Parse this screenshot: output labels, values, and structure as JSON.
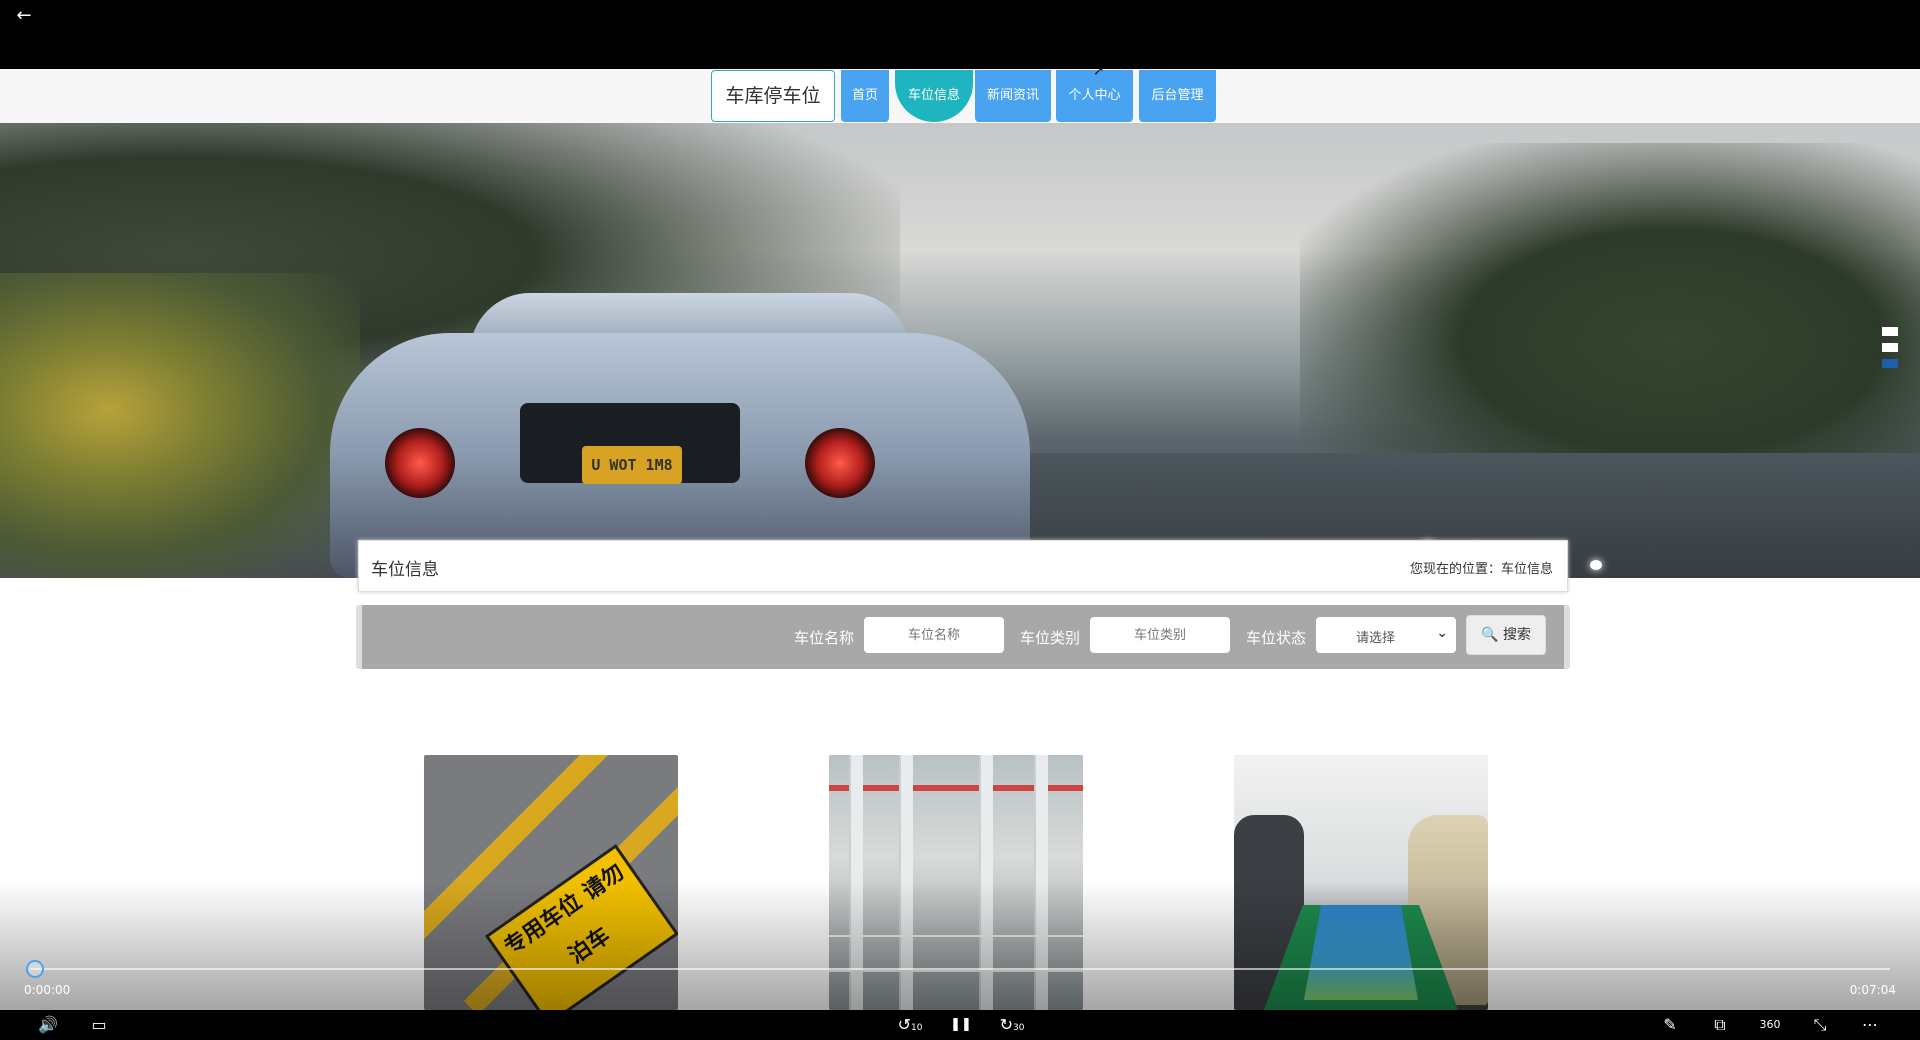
{
  "player": {
    "back_glyph": "←",
    "time_current": "0:00:00",
    "time_total": "0:07:04",
    "progress": 0.0,
    "controls": {
      "volume": "🔊",
      "subtitles": "▭",
      "rewind": "↺",
      "rewind_label": "10",
      "pause": "❚❚",
      "forward": "↻",
      "forward_label": "30",
      "pen": "✎",
      "miniplayer": "⧉",
      "view360": "360",
      "exit_full": "⤡",
      "more": "⋯"
    }
  },
  "nav": {
    "brand": "车库停车位",
    "items": [
      {
        "label": "首页",
        "active": false
      },
      {
        "label": "车位信息",
        "active": true
      },
      {
        "label": "新闻资讯",
        "active": false
      },
      {
        "label": "个人中心",
        "active": false
      },
      {
        "label": "后台管理",
        "active": false
      }
    ]
  },
  "hero": {
    "plate_text": "U WOT 1M8",
    "slide_count": 3,
    "active_slide": 2
  },
  "breadcrumb": {
    "title": "车位信息",
    "location": "您现在的位置：车位信息"
  },
  "search": {
    "name_label": "车位名称",
    "name_placeholder": "车位名称",
    "type_label": "车位类别",
    "type_placeholder": "车位类别",
    "status_label": "车位状态",
    "status_value": "请选择",
    "button_label": "搜索"
  },
  "cards": [
    {
      "sign_text": "专用车位 请勿泊车"
    },
    {},
    {}
  ],
  "colors": {
    "nav_button": "#4aa3f0",
    "nav_active": "#1fb5c0",
    "search_bar": "#a8a8a8"
  }
}
